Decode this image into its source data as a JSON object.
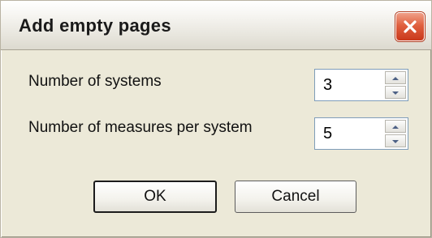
{
  "dialog": {
    "title": "Add empty pages",
    "close_icon": "close-x-icon"
  },
  "fields": {
    "systems": {
      "label": "Number of systems",
      "value": "3"
    },
    "measures": {
      "label": "Number of measures per system",
      "value": "5"
    }
  },
  "buttons": {
    "ok_label": "OK",
    "cancel_label": "Cancel"
  },
  "colors": {
    "dialog_bg": "#ece9d8",
    "close_button": "#e0603f",
    "input_border": "#7f9db9"
  }
}
